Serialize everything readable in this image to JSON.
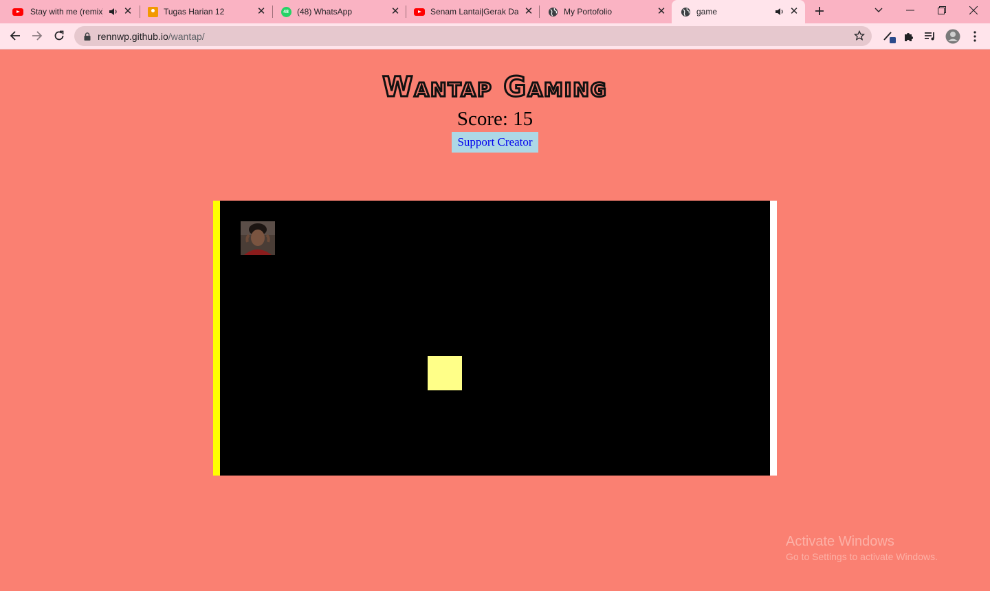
{
  "browser": {
    "tabs": [
      {
        "title": "Stay with me (remix)",
        "icon": "youtube-icon",
        "audio": true
      },
      {
        "title": "Tugas Harian 12",
        "icon": "classroom-icon",
        "audio": false
      },
      {
        "title": "(48) WhatsApp",
        "icon": "whatsapp-icon",
        "badge": "48",
        "audio": false
      },
      {
        "title": "Senam Lantai|Gerak Da",
        "icon": "youtube-icon",
        "audio": false
      },
      {
        "title": "My Portofolio",
        "icon": "globe-icon",
        "audio": false
      },
      {
        "title": "game",
        "icon": "globe-icon",
        "audio": true,
        "active": true
      }
    ],
    "url_host": "rennwp.github.io",
    "url_path": "/wantap/",
    "colors": {
      "tabbar": "#FAB3C3",
      "toolbar": "#FFE4EB",
      "omnibox": "#E6C8CE"
    }
  },
  "page": {
    "title": "Wantap Gaming",
    "score_label": "Score:",
    "score_value": "15",
    "support_button": "Support Creator",
    "background": "#FA8072"
  },
  "game": {
    "left_wall_color": "#FFFF00",
    "right_wall_color": "#FFFFFF",
    "target_color": "#FFFF88",
    "board_color": "#000000"
  },
  "watermark": {
    "line1": "Activate Windows",
    "line2": "Go to Settings to activate Windows."
  }
}
